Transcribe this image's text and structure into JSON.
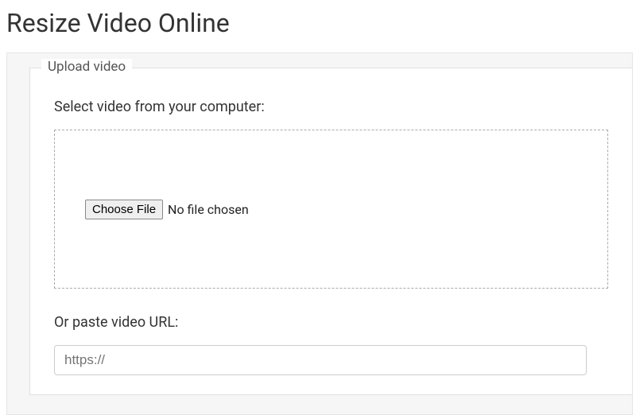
{
  "page": {
    "title": "Resize Video Online"
  },
  "upload": {
    "legend": "Upload video",
    "select_label": "Select video from your computer:",
    "choose_button": "Choose File",
    "file_status": "No file chosen",
    "url_label": "Or paste video URL:",
    "url_placeholder": "https://"
  }
}
